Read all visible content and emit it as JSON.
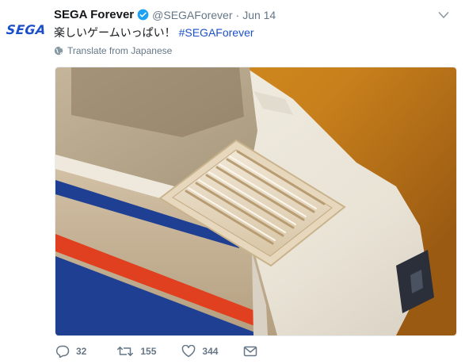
{
  "tweet": {
    "avatar_text": "SEGA",
    "author_name": "SEGA Forever",
    "handle": "@SEGAForever",
    "separator": "·",
    "date": "Jun 14",
    "text": "楽しいゲームいっぱい！",
    "hashtag": "#SEGAForever",
    "translate_label": "Translate from Japanese",
    "media_alt": "",
    "reply_count": "32",
    "retweet_count": "155",
    "like_count": "344"
  },
  "colors": {
    "brand_blue": "#1b50c8",
    "muted_text": "#657786",
    "verified_blue": "#1da1f2",
    "console_stripe_red": "#e0401f",
    "console_stripe_blue": "#1f3f93"
  },
  "icons": [
    "verified-icon",
    "chevron-down-icon",
    "globe-icon",
    "reply-icon",
    "retweet-icon",
    "like-icon",
    "message-icon"
  ]
}
